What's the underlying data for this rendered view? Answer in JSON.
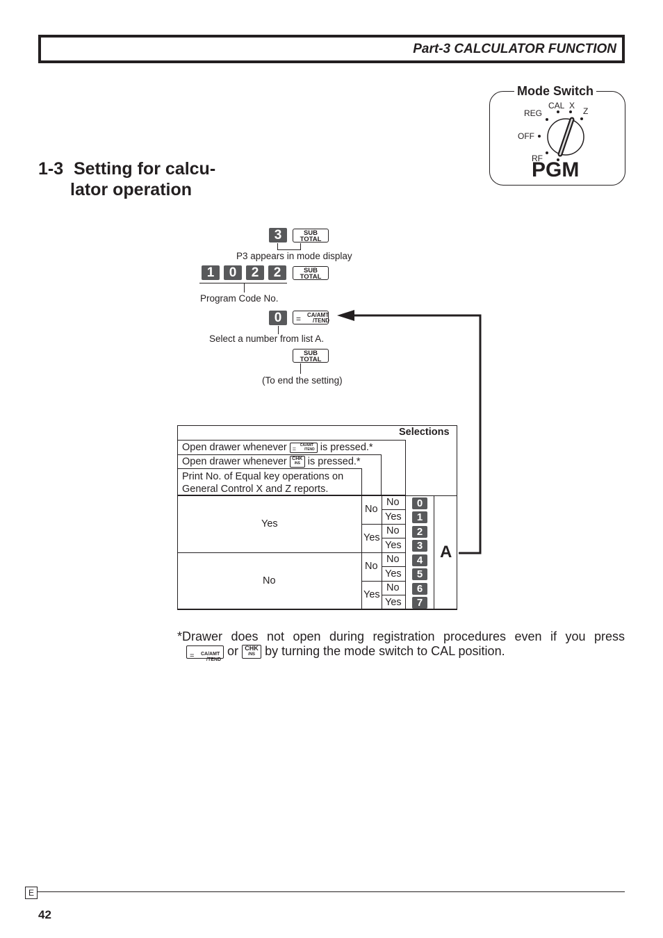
{
  "header": {
    "title": "Part-3 CALCULATOR FUNCTION"
  },
  "section": {
    "number": "1-3",
    "title_line1": "Setting for calcu-",
    "title_line2": "lator operation"
  },
  "mode_switch": {
    "title": "Mode Switch",
    "positions": [
      "REG",
      "CAL",
      "X",
      "Z",
      "OFF",
      "RF",
      "PGM"
    ],
    "selected": "PGM"
  },
  "procedure": {
    "step1_key": "3",
    "subtotal_top": "SUB",
    "subtotal_bottom": "TOTAL",
    "step1_note": "P3 appears in mode display",
    "step2_keys": [
      "1",
      "0",
      "2",
      "2"
    ],
    "step2_note": "Program Code No.",
    "step3_key": "0",
    "ca_key_eq": "=",
    "ca_key_top": "CA/AMT",
    "ca_key_bottom": "/TEND",
    "step3_note": "Select a number from list A.",
    "step4_note": "(To end the setting)"
  },
  "table": {
    "header": "Selections",
    "rows_desc": [
      "Open drawer whenever",
      "is pressed.*",
      "Open drawer whenever",
      "is pressed.*",
      "Print No. of Equal key operations on",
      "General Control X and Z reports."
    ],
    "chk_top": "CHK",
    "chk_bottom": "/NS",
    "col1": [
      "Yes",
      "No"
    ],
    "col2": [
      "No",
      "Yes",
      "No",
      "Yes"
    ],
    "col3": [
      "No",
      "Yes",
      "No",
      "Yes",
      "No",
      "Yes",
      "No",
      "Yes"
    ],
    "values": [
      "0",
      "1",
      "2",
      "3",
      "4",
      "5",
      "6",
      "7"
    ],
    "list_label": "A"
  },
  "footnote": {
    "line1": "*Drawer does not open during registration procedures even if you press",
    "or": "or",
    "line2": "by turning the mode switch to CAL position."
  },
  "footer": {
    "lang": "E",
    "page": "42"
  }
}
